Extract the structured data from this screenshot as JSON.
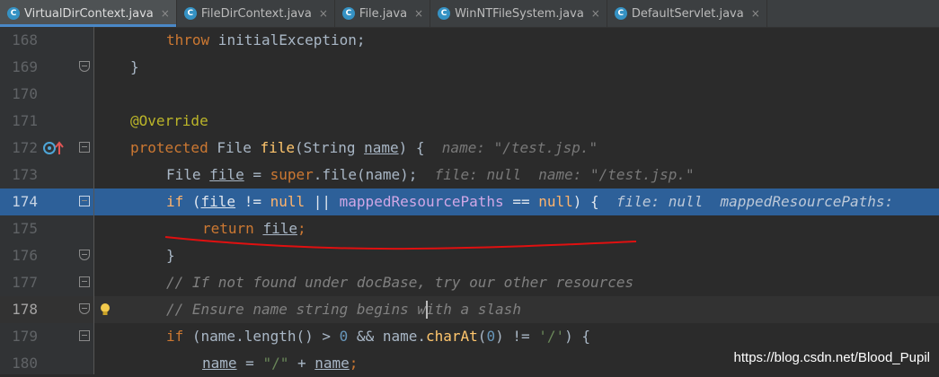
{
  "tabs": [
    {
      "label": "VirtualDirContext.java",
      "icon": "C",
      "active": true
    },
    {
      "label": "FileDirContext.java",
      "icon": "C",
      "active": false
    },
    {
      "label": "File.java",
      "icon": "C",
      "active": false
    },
    {
      "label": "WinNTFileSystem.java",
      "icon": "C",
      "active": false
    },
    {
      "label": "DefaultServlet.java",
      "icon": "C",
      "active": false
    }
  ],
  "tab_close_glyph": "×",
  "lines": [
    {
      "num": "168"
    },
    {
      "num": "169"
    },
    {
      "num": "170"
    },
    {
      "num": "171"
    },
    {
      "num": "172"
    },
    {
      "num": "173"
    },
    {
      "num": "174"
    },
    {
      "num": "175"
    },
    {
      "num": "176"
    },
    {
      "num": "177"
    },
    {
      "num": "178"
    },
    {
      "num": "179"
    },
    {
      "num": "180"
    }
  ],
  "code": {
    "l168": {
      "throw": "throw",
      "rest": " initialException;"
    },
    "l169": {
      "brace": "}"
    },
    "l171": {
      "annotation": "@Override"
    },
    "l172": {
      "protected": "protected",
      "type": " File ",
      "fn": "file",
      "open": "(String ",
      "param": "name",
      "close": ") {",
      "hint": "name: \"/test.jsp.\""
    },
    "l173": {
      "type": "File ",
      "var": "file",
      "eq": " = ",
      "super": "super",
      "call": ".file(name);",
      "hint": "file: null  name: \"/test.jsp.\""
    },
    "l174": {
      "if": "if",
      "open": " (",
      "var": "file",
      "ne": " != ",
      "null1": "null",
      "or": " || ",
      "field": "mappedResourcePaths",
      "eq": " == ",
      "null2": "null",
      "close": ") {",
      "hint": "file: null  mappedResourcePaths:"
    },
    "l175": {
      "return": "return",
      "var": "file",
      "semi": ";"
    },
    "l176": {
      "brace": "}"
    },
    "l177": {
      "comment": "// If not found under docBase, try our other resources"
    },
    "l178": {
      "comment": "// Ensure name string begins with a slash"
    },
    "l179": {
      "if": "if",
      "a": " (name.length() > ",
      "zero1": "0",
      "b": " && name.",
      "charAt": "charAt",
      "c": "(",
      "zero2": "0",
      "d": ") != ",
      "str": "'/'",
      "e": ") {"
    },
    "l180": {
      "var": "name",
      "eq": " = ",
      "str": "\"/\"",
      "plus": " + ",
      "name2": "name",
      "semi": ";"
    }
  },
  "watermark": "https://blog.csdn.net/Blood_Pupil",
  "colors": {
    "selection": "#2d6099",
    "annotation_underline": "#e01010",
    "tab_accent": "#4a88c7"
  }
}
